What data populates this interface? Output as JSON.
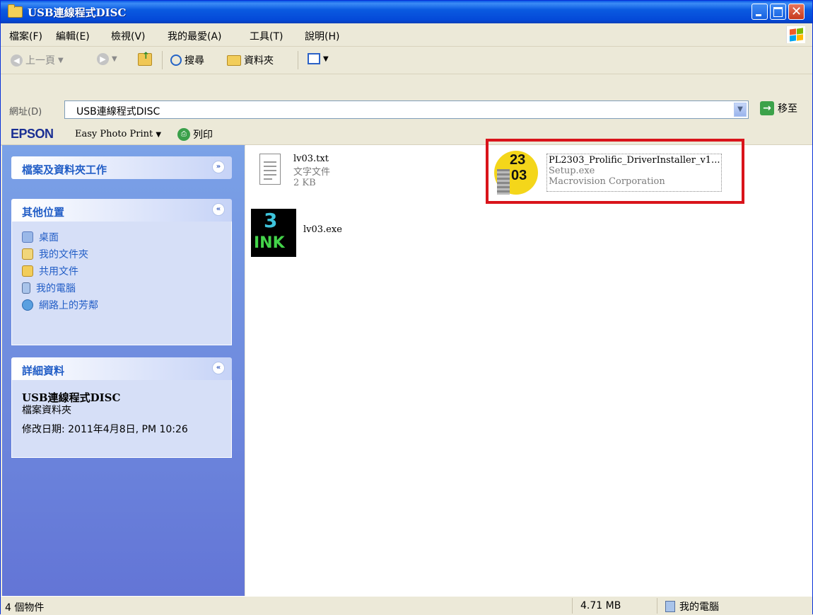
{
  "window": {
    "title": "USB連線程式DISC"
  },
  "menu": [
    "檔案(F)",
    "編輯(E)",
    "檢視(V)",
    "我的最愛(A)",
    "工具(T)",
    "說明(H)"
  ],
  "toolbar": {
    "back": "上一頁",
    "search": "搜尋",
    "folders": "資料夾"
  },
  "address": {
    "label": "網址(D)",
    "value": "USB連線程式DISC",
    "go": "移至"
  },
  "epson": {
    "logo": "EPSON",
    "app": "Easy Photo Print",
    "print": "列印"
  },
  "left": {
    "tasks_title": "檔案及資料夾工作",
    "other_title": "其他位置",
    "other_links": [
      "桌面",
      "我的文件夾",
      "共用文件",
      "我的電腦",
      "網路上的芳鄰"
    ],
    "details_title": "詳細資料",
    "details_name": "USB連線程式DISC",
    "details_type": "檔案資料夾",
    "details_modified": "修改日期: 2011年4月8日, PM 10:26"
  },
  "files": [
    {
      "name": "lv03.txt",
      "type": "文字文件",
      "size": "2 KB"
    },
    {
      "name": "lv03.exe"
    },
    {
      "name": "PL2303_Prolific_DriverInstaller_v1...",
      "desc": "Setup.exe",
      "company": "Macrovision Corporation"
    }
  ],
  "icons": {
    "ink_text_top": "3",
    "ink_text_bottom": "INK",
    "pl_top": "23",
    "pl_bottom": "03"
  },
  "status": {
    "count": "4 個物件",
    "size": "4.71 MB",
    "zone": "我的電腦"
  },
  "colors": {
    "titlebar": "#0a5ae0",
    "taskpane": "#6f8fdf",
    "highlight": "#d9141b"
  }
}
